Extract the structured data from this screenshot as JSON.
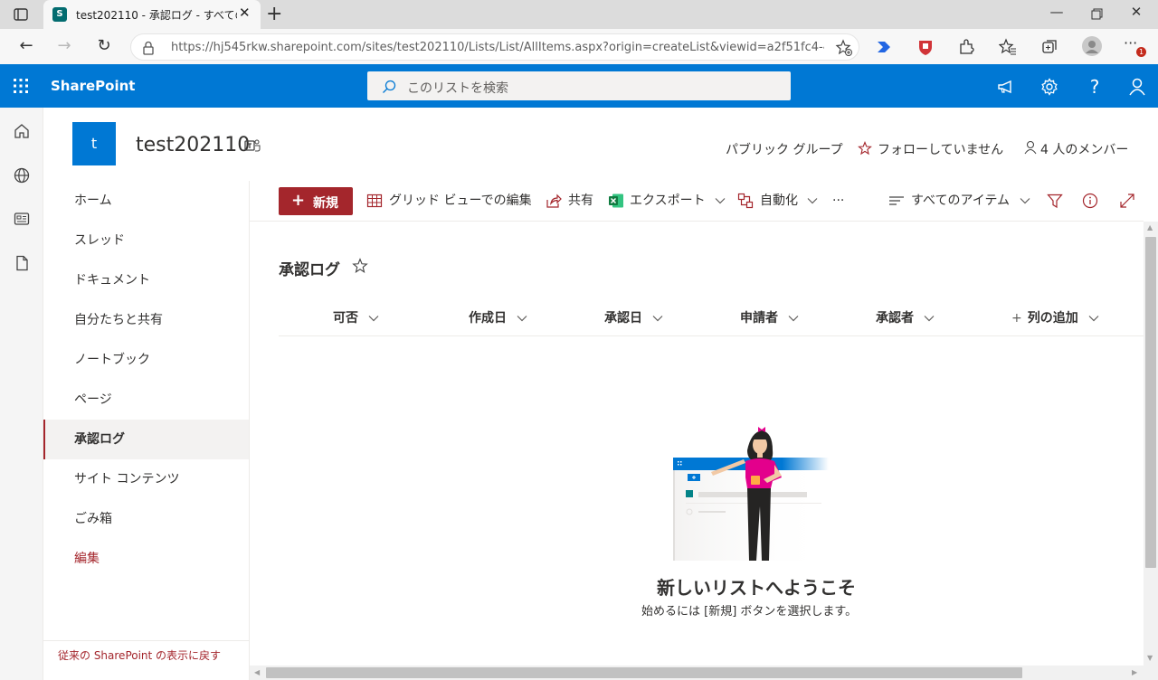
{
  "browser": {
    "tab_title": "test202110 - 承認ログ - すべてのア",
    "favicon_letter": "S",
    "url": "https://hj545rkw.sharepoint.com/sites/test202110/Lists/List/AllItems.aspx?origin=createList&viewid=a2f51fc4-449a...",
    "window_controls": [
      "minimize-icon",
      "restore-icon",
      "close-icon"
    ]
  },
  "suite": {
    "brand": "SharePoint",
    "search_placeholder": "このリストを検索",
    "accent": "#0078d4"
  },
  "site": {
    "logo_letter": "t",
    "title": "test202110",
    "group_type": "パブリック グループ",
    "follow": "フォローしていません",
    "members": "4 人のメンバー"
  },
  "nav": {
    "items": [
      {
        "label": "ホーム"
      },
      {
        "label": "スレッド"
      },
      {
        "label": "ドキュメント"
      },
      {
        "label": "自分たちと共有"
      },
      {
        "label": "ノートブック"
      },
      {
        "label": "ページ"
      },
      {
        "label": "承認ログ",
        "selected": true
      },
      {
        "label": "サイト コンテンツ"
      },
      {
        "label": "ごみ箱"
      },
      {
        "label": "編集"
      }
    ],
    "classic_link": "従来の SharePoint の表示に戻す"
  },
  "commands": {
    "new": "新規",
    "grid_edit": "グリッド ビューでの編集",
    "share": "共有",
    "export": "エクスポート",
    "automate": "自動化",
    "more": "···",
    "view": "すべてのアイテム",
    "new_color": "#a4262c"
  },
  "list": {
    "title": "承認ログ",
    "columns": [
      "可否",
      "作成日",
      "承認日",
      "申請者",
      "承認者"
    ],
    "add_column": "列の追加",
    "empty_title": "新しいリストへようこそ",
    "empty_subtitle": "始めるには [新規] ボタンを選択します。"
  }
}
